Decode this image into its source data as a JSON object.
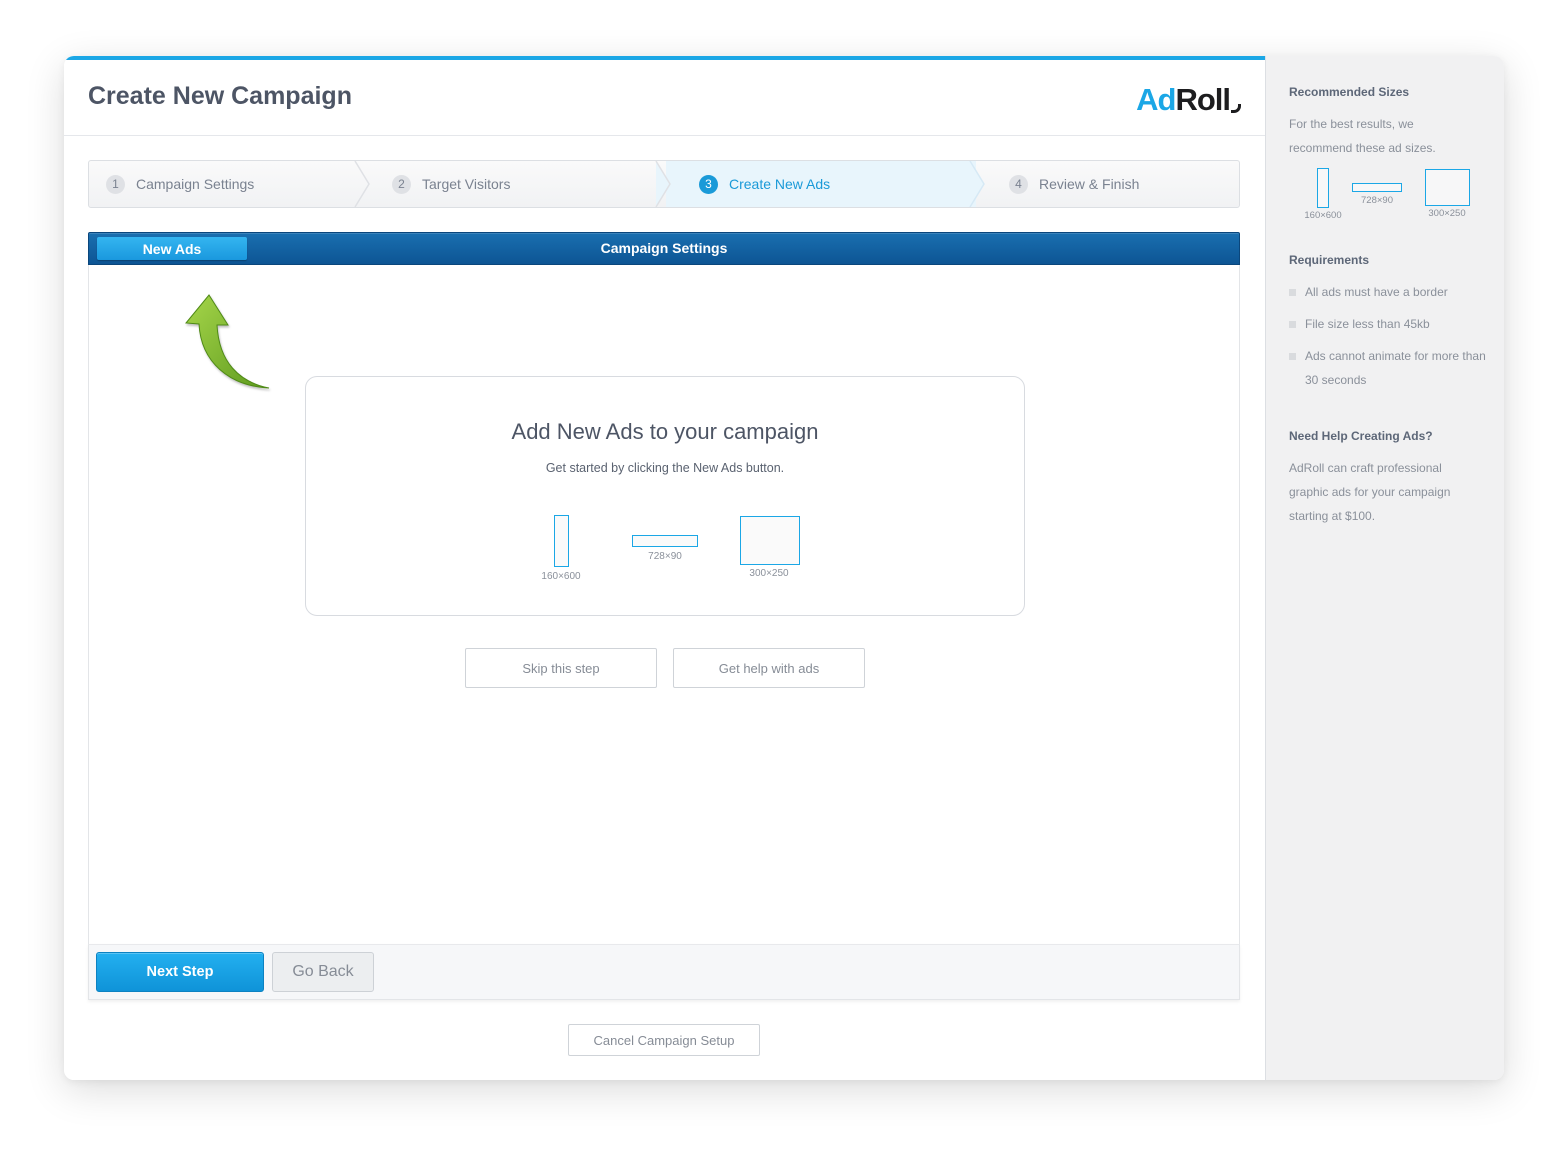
{
  "header": {
    "title": "Create New Campaign",
    "logo_ad": "Ad",
    "logo_roll": "Roll"
  },
  "steps": [
    {
      "num": "1",
      "label": "Campaign Settings",
      "active": false
    },
    {
      "num": "2",
      "label": "Target Visitors",
      "active": false
    },
    {
      "num": "3",
      "label": "Create New Ads",
      "active": true
    },
    {
      "num": "4",
      "label": "Review & Finish",
      "active": false
    }
  ],
  "toolbar": {
    "tab_label": "New Ads",
    "section_title": "Campaign Settings"
  },
  "card": {
    "title": "Add New Ads to your campaign",
    "subtitle": "Get started by clicking the New Ads button.",
    "sizes": [
      "160×600",
      "728×90",
      "300×250"
    ]
  },
  "actions": {
    "skip": "Skip this step",
    "help": "Get help with ads",
    "next": "Next Step",
    "back": "Go Back",
    "cancel": "Cancel Campaign Setup"
  },
  "sidebar": {
    "recommended_heading": "Recommended Sizes",
    "recommended_text": "For the best results, we recommend these ad sizes.",
    "sizes": [
      "160×600",
      "728×90",
      "300×250"
    ],
    "requirements_heading": "Requirements",
    "requirements": [
      "All ads must have a border",
      "File size less than 45kb",
      "Ads cannot animate for more than 30 seconds"
    ],
    "help_heading": "Need Help Creating Ads?",
    "help_text": "AdRoll can craft professional graphic ads for your campaign starting at $100."
  },
  "colors": {
    "accent": "#1ba7e6",
    "toolbar": "#0d5594",
    "arrow": "#8cc63f"
  }
}
